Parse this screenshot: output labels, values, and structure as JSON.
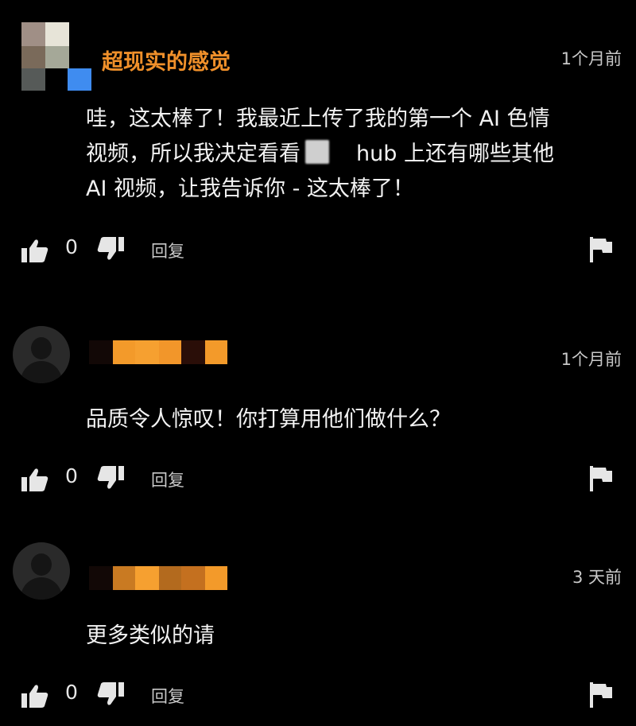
{
  "comments": [
    {
      "username": "超现实的感觉",
      "time": "1个月前",
      "body": {
        "line1": "哇，这太棒了！我最近上传了我的第一个 AI 色情",
        "line2a": "视频，所以我决定看看",
        "line2b": "hub 上还有哪些其他",
        "line3": "AI 视频，让我告诉你 - 这太棒了！"
      },
      "likes": "0",
      "reply_label": "回复"
    },
    {
      "time": "1个月前",
      "body": "品质令人惊叹！你打算用他们做什么？",
      "likes": "0",
      "reply_label": "回复"
    },
    {
      "time": "3 天前",
      "body": "更多类似的请",
      "likes": "0",
      "reply_label": "回复"
    }
  ],
  "icons": [
    "thumbs-up-icon",
    "thumbs-down-icon",
    "flag-icon"
  ],
  "colors": {
    "background": "#000000",
    "username": "#f0902a",
    "blurred_name_orange": "#f39a2a",
    "text": "#f2f2f2",
    "meta": "#c8c8c8"
  }
}
